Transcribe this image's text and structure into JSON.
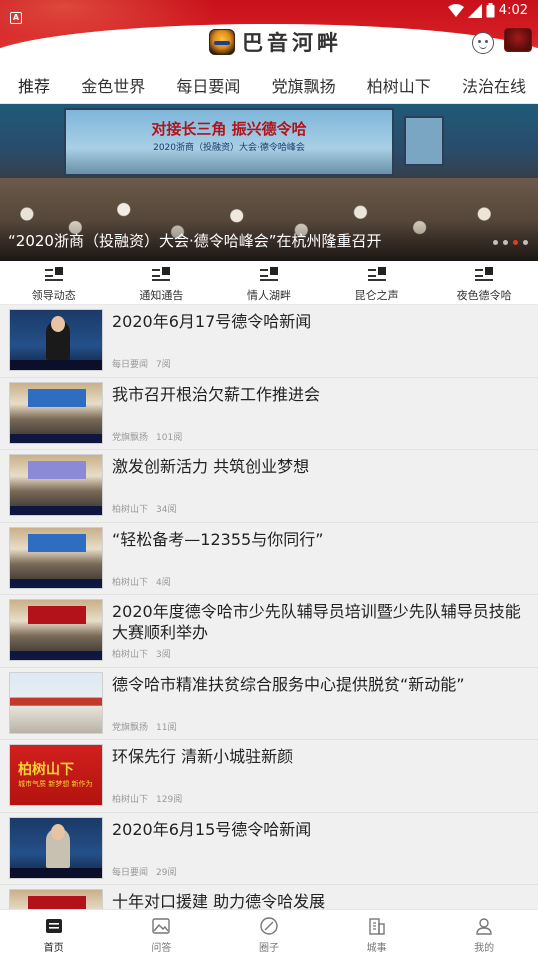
{
  "status_bar": {
    "notification_badge": "A",
    "time": "4:02",
    "icons": [
      "wifi-icon",
      "signal-icon",
      "battery-icon"
    ]
  },
  "header": {
    "app_title": "巴音河畔",
    "left_icon": "app-logo",
    "right_icons": [
      "mascot-icon",
      "avatar-icon"
    ]
  },
  "category_tabs": [
    {
      "label": "推荐",
      "active": true
    },
    {
      "label": "金色世界",
      "active": false
    },
    {
      "label": "每日要闻",
      "active": false
    },
    {
      "label": "党旗飘扬",
      "active": false
    },
    {
      "label": "柏树山下",
      "active": false
    },
    {
      "label": "法治在线",
      "active": false
    }
  ],
  "hero": {
    "screen_heading": "对接长三角 振兴德令哈",
    "screen_subheading": "2020浙商（投融资）大会·德令哈峰会",
    "caption": "“2020浙商（投融资）大会·德令哈峰会”在杭州隆重召开",
    "dots_count": 4,
    "active_dot": 2
  },
  "quick_nav": [
    {
      "label": "领导动态",
      "icon": "list-icon"
    },
    {
      "label": "通知通告",
      "icon": "list-icon"
    },
    {
      "label": "情人湖畔",
      "icon": "list-icon"
    },
    {
      "label": "昆仑之声",
      "icon": "grid-icon"
    },
    {
      "label": "夜色德令哈",
      "icon": "list-icon"
    }
  ],
  "news": [
    {
      "title": "2020年6月17号德令哈新闻",
      "category": "每日要闻",
      "views": "7阅",
      "thumb": "anchor-male"
    },
    {
      "title": "我市召开根治欠薪工作推进会",
      "category": "党旗飘扬",
      "views": "101阅",
      "thumb": "meeting-blue"
    },
    {
      "title": "激发创新活力 共筑创业梦想",
      "category": "柏树山下",
      "views": "34阅",
      "thumb": "meeting-lav"
    },
    {
      "title": "“轻松备考—12355与你同行”",
      "category": "柏树山下",
      "views": "4阅",
      "thumb": "meeting-blue"
    },
    {
      "title": "2020年度德令哈市少先队辅导员培训暨少先队辅导员技能大赛顺利举办",
      "category": "柏树山下",
      "views": "3阅",
      "thumb": "meeting-red"
    },
    {
      "title": "德令哈市精准扶贫综合服务中心提供脱贫“新动能”",
      "category": "党旗飘扬",
      "views": "11阅",
      "thumb": "building"
    },
    {
      "title": "环保先行 清新小城驻新颜",
      "category": "柏树山下",
      "views": "129阅",
      "thumb": "red-banner",
      "thumb_text": "柏树山下",
      "thumb_subtext": "城市气质 新梦想 新作为"
    },
    {
      "title": "2020年6月15号德令哈新闻",
      "category": "每日要闻",
      "views": "29阅",
      "thumb": "anchor-female"
    },
    {
      "title": "十年对口援建 助力德令哈发展",
      "category": "",
      "views": "",
      "thumb": "meeting-red"
    }
  ],
  "bottom_nav": [
    {
      "label": "首页",
      "icon": "home-icon",
      "active": true
    },
    {
      "label": "问答",
      "icon": "image-icon",
      "active": false
    },
    {
      "label": "圈子",
      "icon": "compass-icon",
      "active": false
    },
    {
      "label": "城事",
      "icon": "building-icon",
      "active": false
    },
    {
      "label": "我的",
      "icon": "user-icon",
      "active": false
    }
  ],
  "colors": {
    "brand_red": "#d41e24",
    "active_dot": "#e23b2e",
    "list_background": "#f0f0f0"
  }
}
